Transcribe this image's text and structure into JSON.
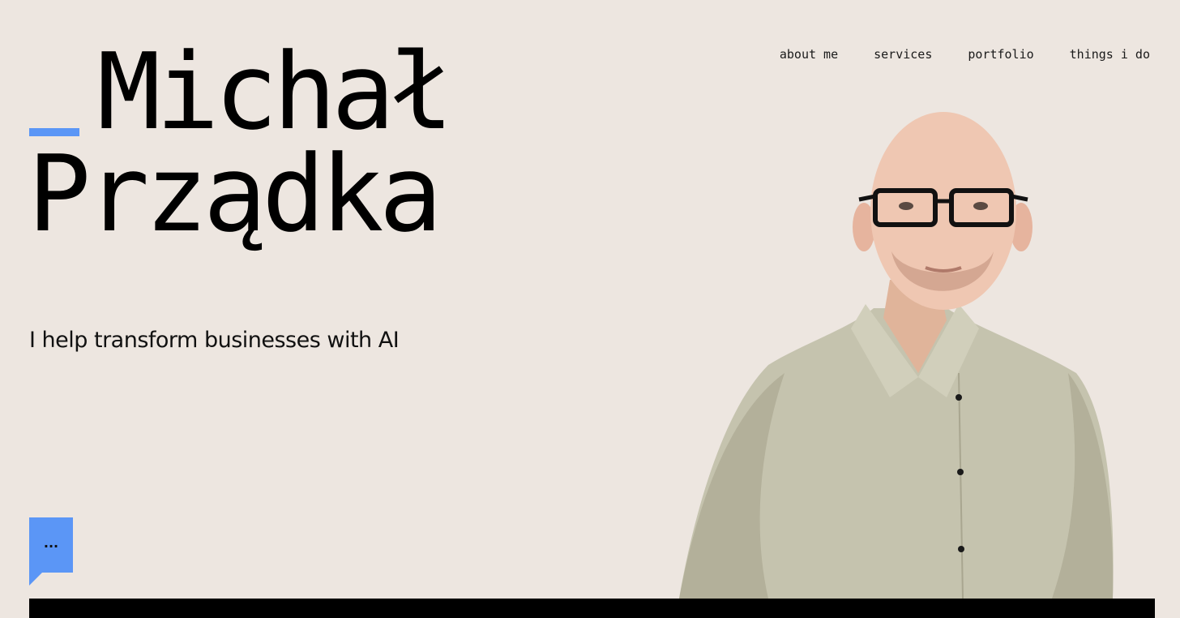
{
  "nav": {
    "items": [
      {
        "label": "about me"
      },
      {
        "label": "services"
      },
      {
        "label": "portfolio"
      },
      {
        "label": "things i do"
      }
    ]
  },
  "hero": {
    "first_name": "Michał",
    "last_name": "Prządka",
    "tagline": "I help transform businesses with AI"
  },
  "chat": {
    "label": "..."
  },
  "colors": {
    "background": "#ede6e0",
    "accent": "#5b96f6",
    "text": "#000000",
    "shirt": "#c5c3ae"
  },
  "icons": {
    "chat": "speech-bubble-icon"
  }
}
